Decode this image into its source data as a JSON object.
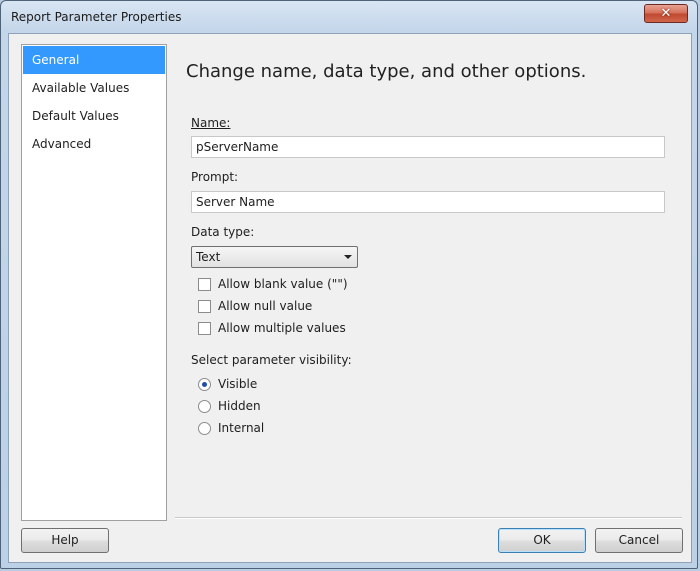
{
  "window": {
    "title": "Report Parameter Properties",
    "close_glyph": "✕"
  },
  "nav": {
    "items": [
      "General",
      "Available Values",
      "Default Values",
      "Advanced"
    ],
    "selected": "General"
  },
  "page": {
    "heading": "Change name, data type, and other options.",
    "name": {
      "label": "Name:",
      "value": "pServerName"
    },
    "prompt": {
      "label": "Prompt:",
      "value": "Server Name"
    },
    "data_type": {
      "label": "Data type:",
      "value": "Text"
    },
    "options": [
      {
        "label": "Allow blank value (\"\")",
        "checked": false
      },
      {
        "label": "Allow null value",
        "checked": false
      },
      {
        "label": "Allow multiple values",
        "checked": false
      }
    ],
    "visibility": {
      "label": "Select parameter visibility:",
      "options": [
        {
          "label": "Visible",
          "checked": true
        },
        {
          "label": "Hidden",
          "checked": false
        },
        {
          "label": "Internal",
          "checked": false
        }
      ]
    }
  },
  "footer": {
    "help": "Help",
    "ok": "OK",
    "cancel": "Cancel"
  },
  "colors": {
    "selection": "#3399ff",
    "title_bg": "#c4d6ea",
    "close": "#c04a30"
  }
}
